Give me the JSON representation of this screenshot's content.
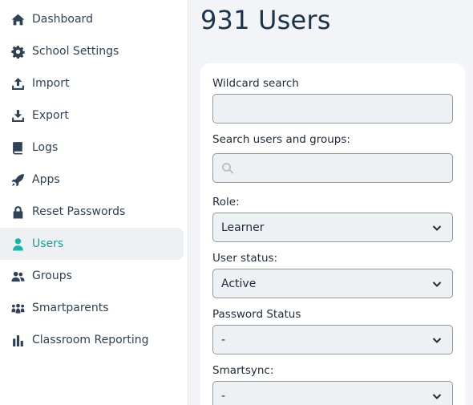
{
  "sidebar": {
    "items": [
      {
        "label": "Dashboard",
        "icon": "home-icon"
      },
      {
        "label": "School Settings",
        "icon": "gear-icon"
      },
      {
        "label": "Import",
        "icon": "upload-icon"
      },
      {
        "label": "Export",
        "icon": "download-icon"
      },
      {
        "label": "Logs",
        "icon": "book-icon"
      },
      {
        "label": "Apps",
        "icon": "rocket-icon"
      },
      {
        "label": "Reset Passwords",
        "icon": "lock-icon"
      },
      {
        "label": "Users",
        "icon": "user-icon",
        "active": true
      },
      {
        "label": "Groups",
        "icon": "users-icon"
      },
      {
        "label": "Smartparents",
        "icon": "people-group-icon"
      },
      {
        "label": "Classroom Reporting",
        "icon": "bar-chart-icon"
      }
    ]
  },
  "main": {
    "title": "931 Users",
    "filters": {
      "wildcard": {
        "label": "Wildcard search",
        "value": "",
        "placeholder": ""
      },
      "search": {
        "label": "Search users and groups:",
        "value": "",
        "placeholder": ""
      },
      "role": {
        "label": "Role:",
        "value": "Learner"
      },
      "user_status": {
        "label": "User status:",
        "value": "Active"
      },
      "password_status": {
        "label": "Password Status",
        "value": "-"
      },
      "smartsync": {
        "label": "Smartsync:",
        "value": "-"
      }
    }
  },
  "colors": {
    "accent": "#1ab3a8",
    "text": "#2f4256",
    "active_bg": "#eef1f4",
    "main_bg": "#f2f4f7"
  }
}
